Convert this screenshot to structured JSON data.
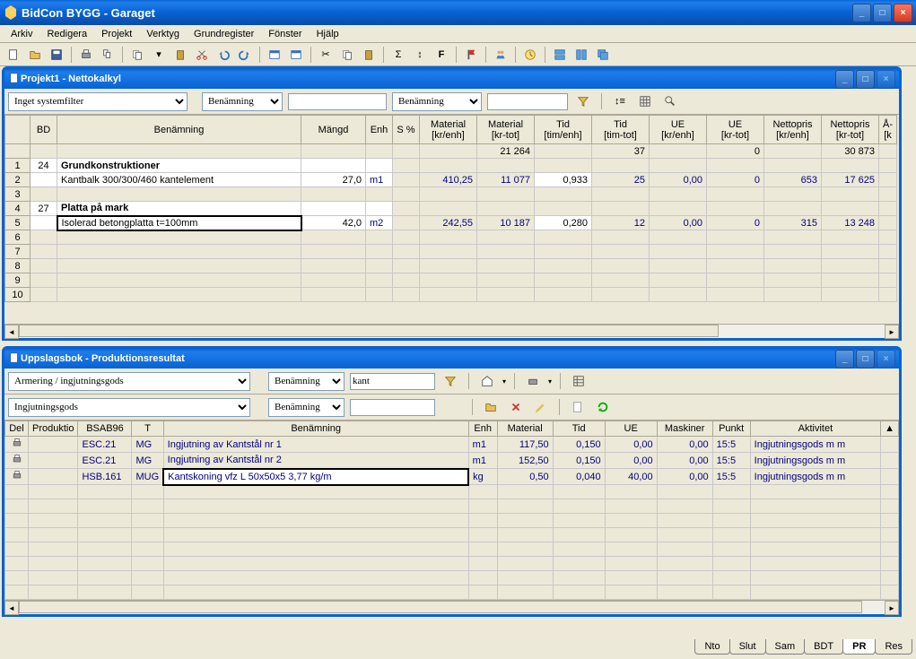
{
  "app": {
    "title": "BidCon BYGG - Garaget"
  },
  "menus": [
    "Arkiv",
    "Redigera",
    "Projekt",
    "Verktyg",
    "Grundregister",
    "Fönster",
    "Hjälp"
  ],
  "window1": {
    "title": "Projekt1 - Nettokalkyl",
    "filter1_options": [
      "Inget systemfilter"
    ],
    "filter1_value": "Inget systemfilter",
    "col_select1": "Benämning",
    "col_select2": "Benämning",
    "columns": [
      "",
      "BD",
      "Benämning",
      "Mängd",
      "Enh",
      "S %",
      "Material\n[kr/enh]",
      "Material\n[kr-tot]",
      "Tid\n[tim/enh]",
      "Tid\n[tim-tot]",
      "UE\n[kr/enh]",
      "UE\n[kr-tot]",
      "Nettopris\n[kr/enh]",
      "Nettopris\n[kr-tot]",
      "Å-\n[k"
    ],
    "totals": {
      "material_tot": "21 264",
      "tid_tot": "37",
      "ue_tot": "0",
      "netto_tot": "30 873"
    },
    "rows": [
      {
        "n": "1",
        "bd": "24",
        "name": "Grundkonstruktioner",
        "bold": true
      },
      {
        "n": "2",
        "bd": "",
        "name": "Kantbalk 300/300/460 kantelement",
        "mangd": "27,0",
        "enh": "m1",
        "mat_enh": "410,25",
        "mat_tot": "11 077",
        "tid_enh": "0,933",
        "tid_tot": "25",
        "ue_enh": "0,00",
        "ue_tot": "0",
        "np_enh": "653",
        "np_tot": "17 625"
      },
      {
        "n": "3",
        "bd": "",
        "name": ""
      },
      {
        "n": "4",
        "bd": "27",
        "name": "Platta på mark",
        "bold": true
      },
      {
        "n": "5",
        "bd": "",
        "name": "Isolerad betongplatta t=100mm",
        "mangd": "42,0",
        "enh": "m2",
        "mat_enh": "242,55",
        "mat_tot": "10 187",
        "tid_enh": "0,280",
        "tid_tot": "12",
        "ue_enh": "0,00",
        "ue_tot": "0",
        "np_enh": "315",
        "np_tot": "13 248",
        "selected": true
      },
      {
        "n": "6"
      },
      {
        "n": "7"
      },
      {
        "n": "8"
      },
      {
        "n": "9"
      },
      {
        "n": "10"
      }
    ]
  },
  "window2": {
    "title": "Uppslagsbok - Produktionsresultat",
    "dd1": "Armering / ingjutningsgods",
    "dd2": "Ingjutningsgods",
    "col_sel1": "Benämning",
    "col_sel2": "Benämning",
    "search": "kant",
    "columns": [
      "Del",
      "Produktio",
      "BSAB96",
      "T",
      "Benämning",
      "Enh",
      "Material",
      "Tid",
      "UE",
      "Maskiner",
      "Punkt",
      "Aktivitet"
    ],
    "rows": [
      {
        "prod": "",
        "bsab": "ESC.21",
        "t": "MG",
        "name": "Ingjutning av Kantstål nr 1",
        "enh": "m1",
        "mat": "117,50",
        "tid": "0,150",
        "ue": "0,00",
        "mask": "0,00",
        "punkt": "15:5",
        "akt": "Ingjutningsgods m m"
      },
      {
        "prod": "",
        "bsab": "ESC.21",
        "t": "MG",
        "name": "Ingjutning av Kantstål nr 2",
        "enh": "m1",
        "mat": "152,50",
        "tid": "0,150",
        "ue": "0,00",
        "mask": "0,00",
        "punkt": "15:5",
        "akt": "Ingjutningsgods m m"
      },
      {
        "prod": "",
        "bsab": "HSB.161",
        "t": "MUG",
        "name": "Kantskoning vfz L 50x50x5 3,77 kg/m",
        "enh": "kg",
        "mat": "0,50",
        "tid": "0,040",
        "ue": "40,00",
        "mask": "0,00",
        "punkt": "15:5",
        "akt": "Ingjutningsgods m m",
        "selected": true
      }
    ]
  },
  "tabs": [
    "Nto",
    "Slut",
    "Sam",
    "BDT",
    "PR",
    "Res"
  ],
  "active_tab": "PR"
}
